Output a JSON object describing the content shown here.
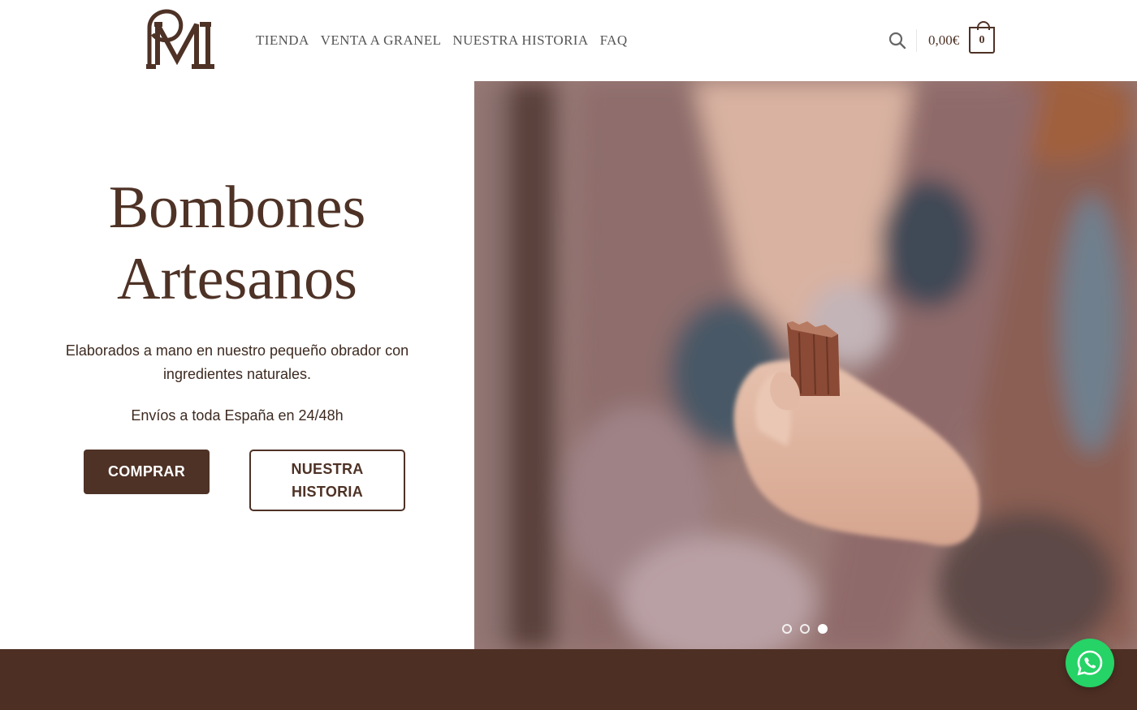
{
  "header": {
    "logo_name": "PM monogram logo",
    "nav": [
      {
        "label": "TIENDA"
      },
      {
        "label": "VENTA A GRANEL"
      },
      {
        "label": "NUESTRA HISTORIA"
      },
      {
        "label": "FAQ"
      }
    ],
    "search_icon": "search-icon",
    "cart_total": "0,00€",
    "cart_count": "0"
  },
  "hero": {
    "title_line1": "Bombones",
    "title_line2": "Artesanos",
    "description": "Elaborados a mano en nuestro pequeño obrador con ingredientes naturales.",
    "shipping": "Envíos a toda España en 24/48h",
    "buy_button": "COMPRAR",
    "story_button": "NUESTRA HISTORIA",
    "slider": {
      "total_slides": 3,
      "active_slide": 3
    }
  },
  "colors": {
    "brand_brown": "#4e3226",
    "footer_band": "#4e2f24",
    "whatsapp_green": "#25d366"
  },
  "whatsapp": {
    "icon": "whatsapp-icon"
  }
}
